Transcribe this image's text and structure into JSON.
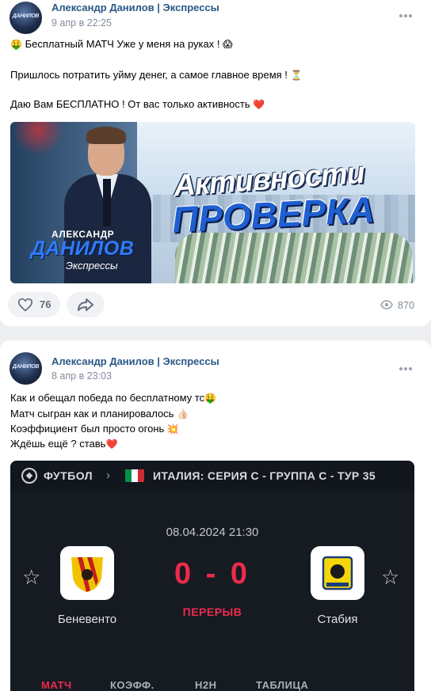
{
  "posts": [
    {
      "author": "Александр Данилов | Экспрессы",
      "avatar_text": "ДАНИЛОВ",
      "date": "9 апр в 22:25",
      "lines": [
        {
          "emoji": "🤑",
          "text": " Бесплатный МАТЧ Уже у меня на руках ! ",
          "emoji_after": "😱"
        },
        {
          "text": "Пришлось потратить уйму денег, а самое главное время ! ",
          "emoji_after": "⏳"
        },
        {
          "text": "Даю Вам БЕСПЛАТНО ! От вас только активность ",
          "emoji_after": "❤️"
        }
      ],
      "banner": {
        "headline_1": "Активности",
        "headline_2": "ПРОВЕРКА",
        "name_1": "АЛЕКСАНДР",
        "name_2": "ДАНИЛОВ",
        "name_3": "Экспрессы"
      },
      "likes": "76",
      "views": "870"
    },
    {
      "author": "Александр Данилов | Экспрессы",
      "avatar_text": "ДАНИЛОВ",
      "date": "8 апр в 23:03",
      "lines": [
        {
          "text": "Как и обещал победа по бесплатному тс",
          "emoji_after": "🤑"
        },
        {
          "text": "Матч сыгран как и планировалось ",
          "emoji_after": "👍🏻"
        },
        {
          "text": "Коэффициент был просто огонь ",
          "emoji_after": "💥"
        },
        {
          "text": "Ждёшь ещё ? ставь",
          "emoji_after": "❤️"
        }
      ],
      "match": {
        "sport": "ФУТБОЛ",
        "league": "ИТАЛИЯ: СЕРИЯ С - ГРУППА С - ТУР 35",
        "datetime": "08.04.2024 21:30",
        "home_team": "Беневенто",
        "away_team": "Стабия",
        "score": "0 - 0",
        "status": "ПЕРЕРЫВ",
        "tabs": [
          "МАТЧ",
          "КОЭФФ.",
          "H2H",
          "ТАБЛИЦА"
        ],
        "active_tab": "МАТЧ",
        "flag_colors": [
          "#009246",
          "#ffffff",
          "#ce2b37"
        ],
        "home_logo_colors": [
          "#f2c200",
          "#c21f1f"
        ],
        "away_logo_colors": [
          "#f5d60a",
          "#1a3d7c"
        ]
      }
    }
  ],
  "colors": {
    "link": "#2a5885",
    "secondary": "#818c99",
    "accent_red": "#ee2a4b",
    "page_bg": "#edeef0"
  }
}
